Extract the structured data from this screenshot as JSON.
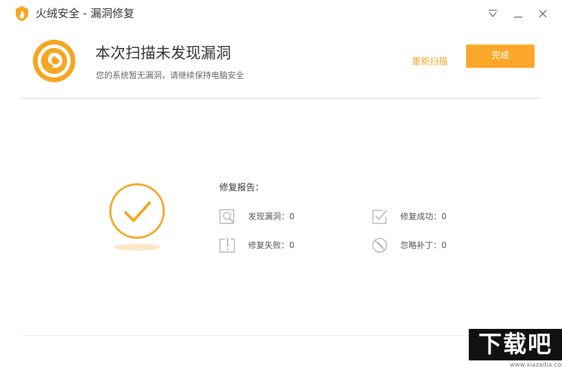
{
  "window": {
    "title": "火绒安全 - 漏洞修复"
  },
  "header": {
    "headline": "本次扫描未发现漏洞",
    "subline": "您的系统暂无漏洞，请继续保持电脑安全",
    "rescan_label": "重新扫描",
    "done_label": "完成"
  },
  "report": {
    "title": "修复报告：",
    "stats": [
      {
        "label": "发现漏洞：0",
        "icon": "search-icon"
      },
      {
        "label": "修复成功：0",
        "icon": "check-square-icon"
      },
      {
        "label": "修复失败：0",
        "icon": "warning-icon"
      },
      {
        "label": "忽略补丁：0",
        "icon": "ignore-icon"
      }
    ]
  },
  "watermark": {
    "logo_text": "下载吧",
    "url": "www.xiazaiba.com"
  },
  "colors": {
    "accent": "#f5a623",
    "button": "#fba82a",
    "icon_gray": "#b9b9b9"
  }
}
